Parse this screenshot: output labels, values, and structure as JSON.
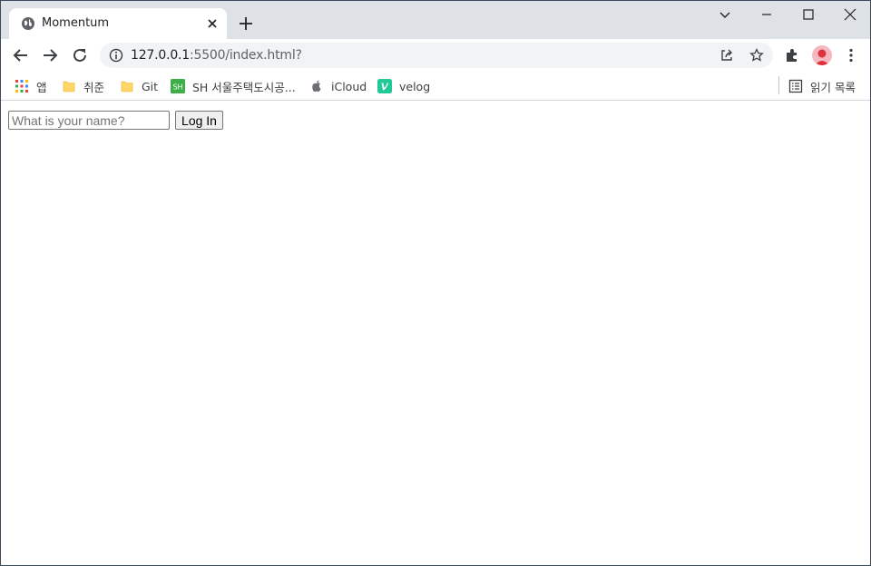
{
  "tab": {
    "title": "Momentum"
  },
  "address_bar": {
    "url_host": "127.0.0.1",
    "url_path": ":5500/index.html?"
  },
  "bookmarks": {
    "items": [
      {
        "label": "앱",
        "icon": "apps-grid-icon"
      },
      {
        "label": "취준",
        "icon": "folder-icon"
      },
      {
        "label": "Git",
        "icon": "folder-icon"
      },
      {
        "label": "SH 서울주택도시공...",
        "icon": "sh-logo-icon"
      },
      {
        "label": "iCloud",
        "icon": "apple-icon"
      },
      {
        "label": "velog",
        "icon": "velog-icon"
      }
    ],
    "reading_list_label": "읽기 목록"
  },
  "login_form": {
    "name_placeholder": "What is your name?",
    "name_value": "",
    "submit_label": "Log In"
  },
  "colors": {
    "titlebar": "#dee1e6",
    "omnibox": "#f1f3f4",
    "folder": "#fdd663",
    "sh_green": "#3fae49",
    "velog_green": "#20c997"
  }
}
